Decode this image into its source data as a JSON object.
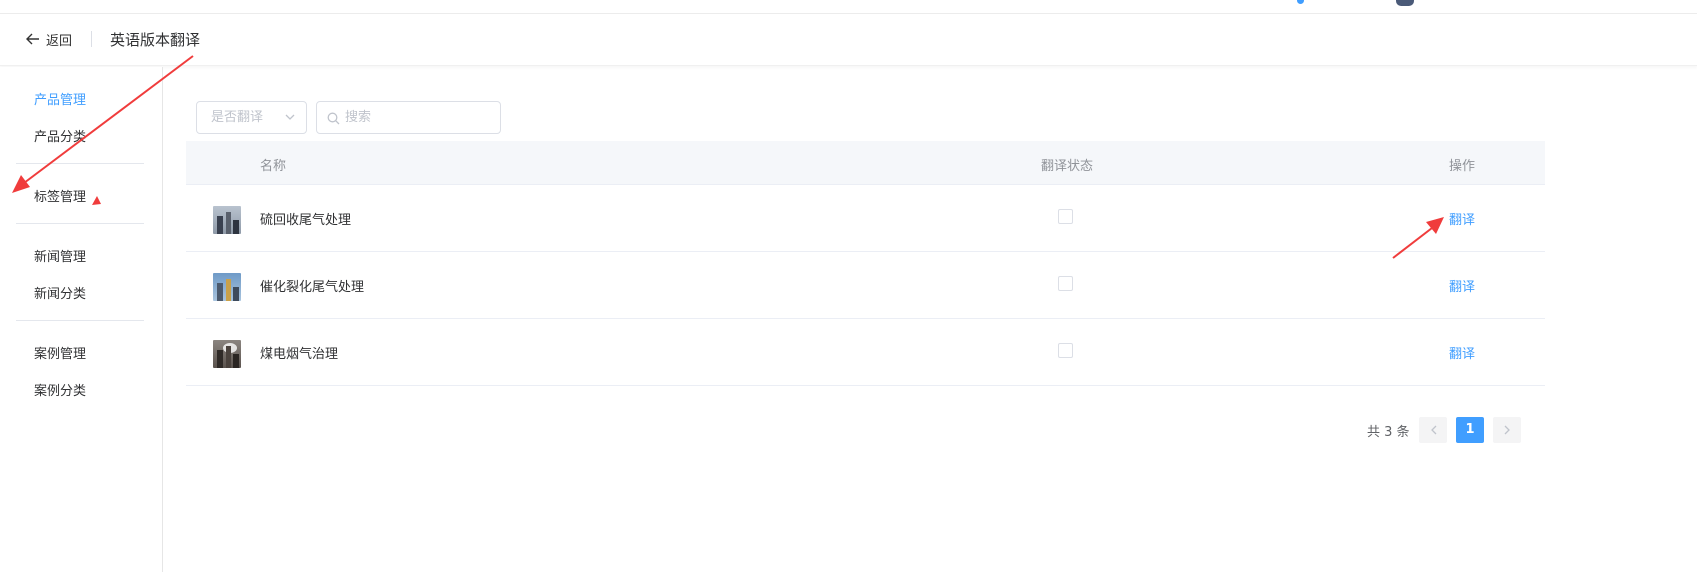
{
  "header": {
    "back_label": "返回",
    "title": "英语版本翻译"
  },
  "sidebar": {
    "items": [
      {
        "label": "产品管理",
        "active": true
      },
      {
        "label": "产品分类",
        "active": false
      },
      {
        "label": "标签管理",
        "active": false
      },
      {
        "label": "新闻管理",
        "active": false
      },
      {
        "label": "新闻分类",
        "active": false
      },
      {
        "label": "案例管理",
        "active": false
      },
      {
        "label": "案例分类",
        "active": false
      }
    ]
  },
  "filters": {
    "translated_select": {
      "placeholder": "是否翻译",
      "icon": "chevron-down-icon"
    },
    "search": {
      "placeholder": "搜索",
      "value": "",
      "icon": "search-icon"
    }
  },
  "table": {
    "columns": {
      "name": "名称",
      "status": "翻译状态",
      "action": "操作"
    },
    "rows": [
      {
        "name": "硫回收尾气处理",
        "translated": false,
        "action": "翻译"
      },
      {
        "name": "催化裂化尾气处理",
        "translated": false,
        "action": "翻译"
      },
      {
        "name": "煤电烟气治理",
        "translated": false,
        "action": "翻译"
      }
    ]
  },
  "pagination": {
    "total_text": "共 3 条",
    "current_page": "1"
  },
  "colors": {
    "accent": "#409eff",
    "annotation_arrow": "#f03c3c"
  }
}
